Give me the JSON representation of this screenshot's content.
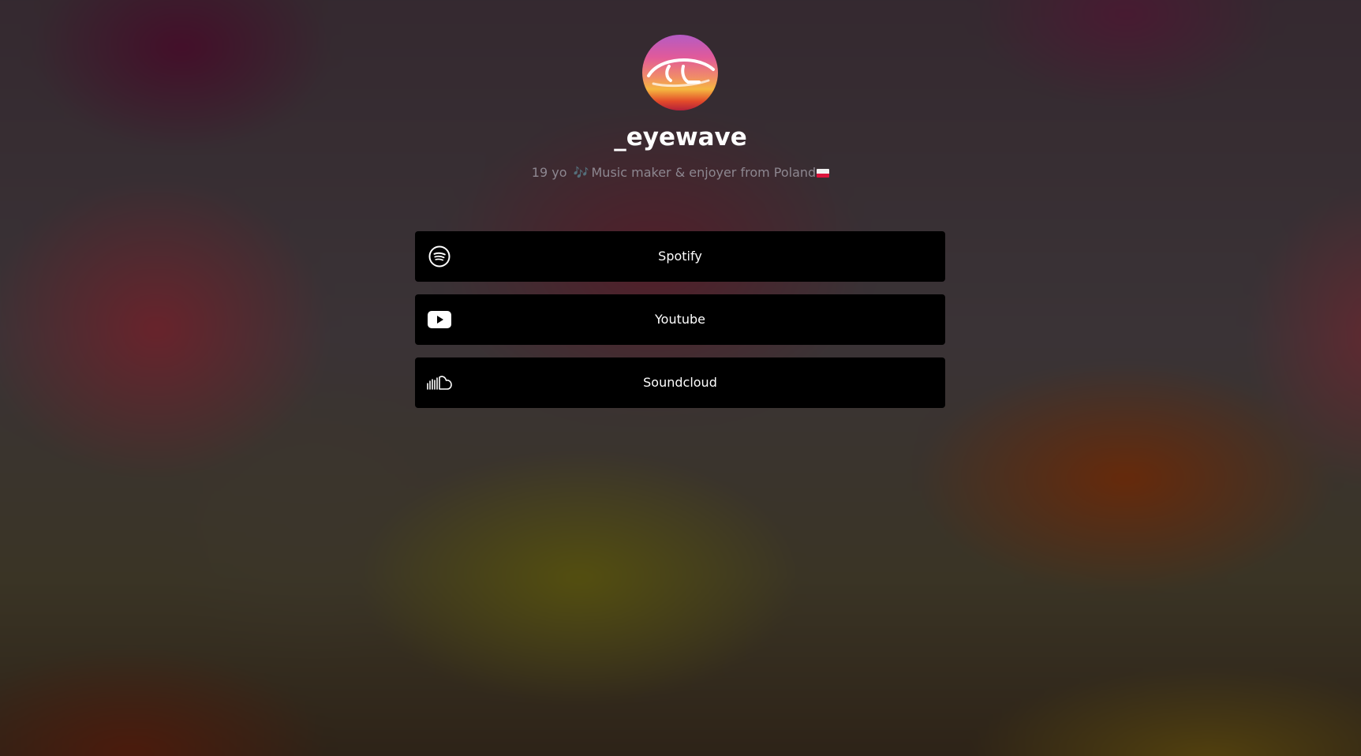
{
  "profile": {
    "name": "_eyewave",
    "bio_text": "19 yo",
    "bio_note_emoji": "🎶",
    "bio_rest": "Music maker & enjoyer from Poland",
    "bio_flag": "poland-flag"
  },
  "links": [
    {
      "label": "Spotify",
      "icon": "spotify-icon"
    },
    {
      "label": "Youtube",
      "icon": "youtube-icon"
    },
    {
      "label": "Soundcloud",
      "icon": "soundcloud-icon"
    }
  ],
  "colors": {
    "button_background": "#000000",
    "button_text": "#ffffff",
    "name_text": "#ffffff",
    "bio_text": "#8d8790"
  }
}
